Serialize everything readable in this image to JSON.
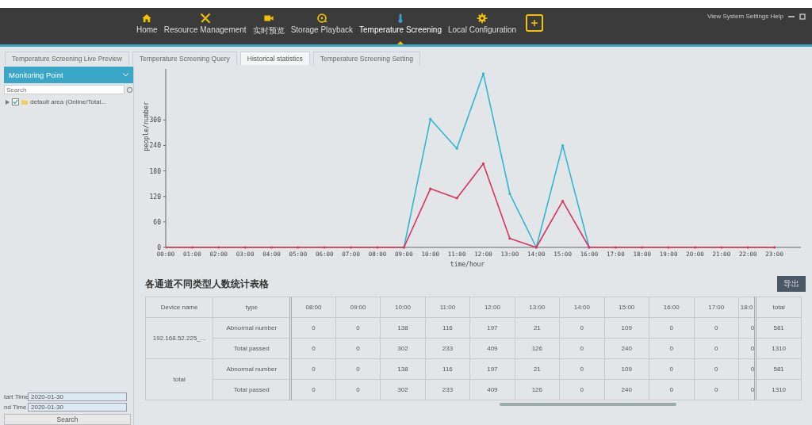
{
  "nav": {
    "items": [
      {
        "label": "Home",
        "selected": false
      },
      {
        "label": "Resource Management",
        "selected": false
      },
      {
        "label": "实时预览",
        "selected": false
      },
      {
        "label": "Storage Playback",
        "selected": false
      },
      {
        "label": "Temperature Screening",
        "selected": true
      },
      {
        "label": "Local Configuration",
        "selected": false
      }
    ],
    "menu": "View System Settings Help"
  },
  "tabs": [
    {
      "label": "Temperature Screening Live Preview",
      "selected": false
    },
    {
      "label": "Temperature Screening Query",
      "selected": false
    },
    {
      "label": "Historical statistics",
      "selected": true
    },
    {
      "label": "Temperature Screening Setting",
      "selected": false
    }
  ],
  "sidebar": {
    "title": "Monitoring Point",
    "search": {
      "placeholder": "Search"
    },
    "tree": [
      {
        "label": "default area (Online/Total...",
        "checked": true,
        "expanded": false
      }
    ],
    "start_label": "tart Time",
    "start_value": "2020-01-30",
    "end_label": "nd Time",
    "end_value": "2020-01-30",
    "search_button": "Search"
  },
  "chart": {
    "chart_data": {
      "type": "line",
      "xlabel": "time/hour",
      "ylabel": "people/number",
      "x": [
        0,
        1,
        2,
        3,
        4,
        5,
        6,
        7,
        8,
        9,
        10,
        11,
        12,
        13,
        14,
        15,
        16,
        17,
        18,
        19,
        20,
        21,
        22,
        23
      ],
      "xlim": [
        0,
        24
      ],
      "ylim": [
        0,
        420
      ],
      "xticks": [
        {
          "value": 0,
          "label": "00:00"
        },
        {
          "value": 1,
          "label": "01:00"
        },
        {
          "value": 2,
          "label": "02:00"
        },
        {
          "value": 3,
          "label": "03:00"
        },
        {
          "value": 4,
          "label": "04:00"
        },
        {
          "value": 5,
          "label": "05:00"
        },
        {
          "value": 6,
          "label": "06:00"
        },
        {
          "value": 7,
          "label": "07:00"
        },
        {
          "value": 8,
          "label": "08:00"
        },
        {
          "value": 9,
          "label": "09:00"
        },
        {
          "value": 10,
          "label": "10:00"
        },
        {
          "value": 11,
          "label": "11:00"
        },
        {
          "value": 12,
          "label": "12:00"
        },
        {
          "value": 13,
          "label": "13:00"
        },
        {
          "value": 14,
          "label": "14:00"
        },
        {
          "value": 15,
          "label": "15:00"
        },
        {
          "value": 16,
          "label": "16:00"
        },
        {
          "value": 17,
          "label": "17:00"
        },
        {
          "value": 18,
          "label": "18:00"
        },
        {
          "value": 19,
          "label": "19:00"
        },
        {
          "value": 20,
          "label": "20:00"
        },
        {
          "value": 21,
          "label": "21:00"
        },
        {
          "value": 22,
          "label": "22:00"
        },
        {
          "value": 23,
          "label": "23:00"
        }
      ],
      "yticks": [
        0,
        60,
        120,
        180,
        240,
        300
      ],
      "series": [
        {
          "color": "#2fb6d2",
          "values": [
            null,
            null,
            null,
            null,
            null,
            null,
            null,
            null,
            null,
            0,
            302,
            233,
            409,
            126,
            0,
            240,
            0,
            null,
            null,
            null,
            null,
            null,
            null,
            null
          ]
        },
        {
          "color": "#d8345c",
          "values": [
            0,
            0,
            0,
            0,
            0,
            0,
            0,
            0,
            0,
            0,
            138,
            116,
            197,
            21,
            0,
            109,
            0,
            0,
            0,
            0,
            0,
            0,
            0,
            0
          ]
        }
      ]
    }
  },
  "table": {
    "title": "各通道不同类型人数统计表格",
    "export_button": "导出",
    "columns": [
      "Device name",
      "type",
      "08:00",
      "09:00",
      "10:00",
      "11:00",
      "12:00",
      "13:00",
      "14:00",
      "15:00",
      "16:00",
      "17:00",
      "18:0",
      "total"
    ],
    "groups": [
      {
        "device": "192.168.52.225_...",
        "rows": [
          {
            "type": "Abnormal number",
            "cells": [
              "0",
              "0",
              "138",
              "116",
              "197",
              "21",
              "0",
              "109",
              "0",
              "0",
              "0",
              "581"
            ]
          },
          {
            "type": "Total passed",
            "cells": [
              "0",
              "0",
              "302",
              "233",
              "409",
              "126",
              "0",
              "240",
              "0",
              "0",
              "0",
              "1310"
            ]
          }
        ]
      },
      {
        "device": "total",
        "rows": [
          {
            "type": "Abnormal number",
            "cells": [
              "0",
              "0",
              "138",
              "116",
              "197",
              "21",
              "0",
              "109",
              "0",
              "0",
              "0",
              "581"
            ]
          },
          {
            "type": "Total passed",
            "cells": [
              "0",
              "0",
              "302",
              "233",
              "409",
              "126",
              "0",
              "240",
              "0",
              "0",
              "0",
              "1310"
            ]
          }
        ]
      }
    ]
  }
}
